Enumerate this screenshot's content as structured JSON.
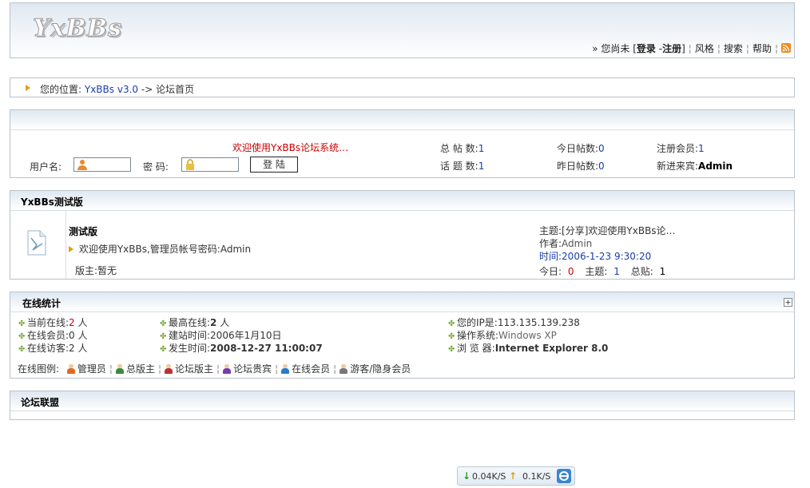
{
  "header": {
    "logo_text": "YxBBs",
    "login_prefix": "» 您尚未",
    "bracket_open": "[",
    "login": "登录",
    "dash": "-",
    "register": "注册",
    "bracket_close": "]",
    "style": "风格",
    "search": "搜索",
    "help": "帮助",
    "rss_icon": "rss-icon"
  },
  "breadcrumb": {
    "prefix": "您的位置:",
    "home": "YxBBs v3.0",
    "arrow": "->",
    "current": "论坛首页"
  },
  "login_panel": {
    "welcome": "欢迎使用YxBBs论坛系统…",
    "username_label": "用户名:",
    "password_label": "密 码:",
    "submit": "登 陆",
    "stats": {
      "total_posts_label": "总 帖 数:",
      "total_posts": "1",
      "topics_label": "话 题 数:",
      "topics": "1",
      "today_label": "今日帖数:",
      "today": "0",
      "yesterday_label": "昨日帖数:",
      "yesterday": "0",
      "members_label": "注册会员:",
      "members": "1",
      "newest_label": "新进来宾:",
      "newest": "Admin"
    }
  },
  "forum_section": {
    "title": "YxBBs测试版",
    "board": {
      "name": "测试版",
      "desc_prefix": "欢迎使用YxBBs,管理员帐号密码:",
      "desc_value": "Admin",
      "mod_label": "版主:",
      "mod_value": "暂无",
      "last_subject_label": "主题:",
      "last_subject": "[分享]欢迎使用YxBBs论…",
      "author_label": "作者:",
      "author": "Admin",
      "time_label": "时间:",
      "time": "2006-1-23 9:30:20",
      "today_label": "今日:",
      "today": "0",
      "topics_label": "主题:",
      "topics": "1",
      "posts_label": "总贴:",
      "posts": "1"
    }
  },
  "online": {
    "title": "在线统计",
    "current_label": "当前在线:",
    "current": "2",
    "members_label": "在线会员:",
    "members": "0",
    "guests_label": "在线访客:",
    "guests": "2",
    "unit": "人",
    "max_label": "最高在线:",
    "max": "2",
    "founded_label": "建站时间:",
    "founded": "2006年1月10日",
    "now_label": "发生时间:",
    "now": "2008-12-27 11:00:07",
    "ip_label": "您的IP是:",
    "ip": "113.135.139.238",
    "os_label": "操作系统:",
    "os": "Windows XP",
    "browser_label": "浏 览 器:",
    "browser": "Internet Explorer 8.0",
    "legend_label": "在线图例:",
    "legend": [
      "管理员",
      "总版主",
      "论坛版主",
      "论坛贵宾",
      "在线会员",
      "游客/隐身会员"
    ],
    "legend_colors": [
      "#e06a20",
      "#3a8a3a",
      "#c03030",
      "#7a3ab0",
      "#2a7ad0",
      "#777777"
    ]
  },
  "links": {
    "title": "论坛联盟"
  },
  "netbar": {
    "down": "0.04K/S",
    "up": "0.1K/S"
  },
  "colors": {
    "accent_blue": "#1a3ea8",
    "accent_red": "#cc0000",
    "border": "#b9c3cc"
  }
}
